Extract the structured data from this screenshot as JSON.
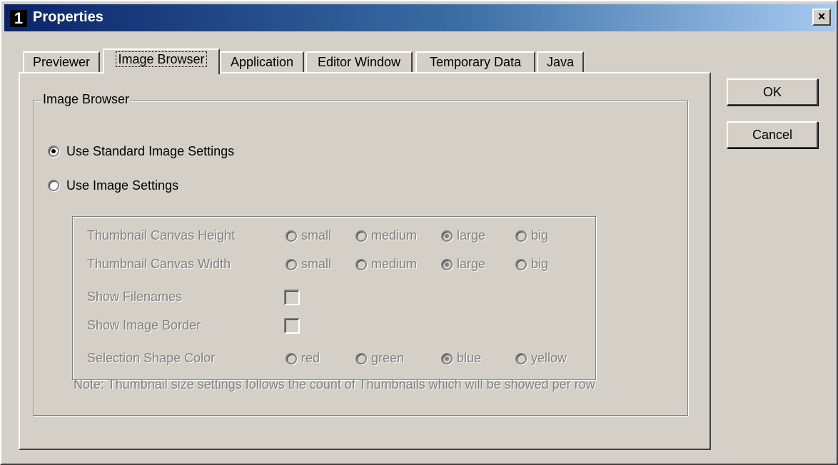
{
  "window": {
    "title": "Properties",
    "app_icon_glyph": "1",
    "close_glyph": "×"
  },
  "tabs": [
    {
      "label": "Previewer"
    },
    {
      "label": "Image Browser",
      "active": true
    },
    {
      "label": "Application"
    },
    {
      "label": "Editor Window"
    },
    {
      "label": "Temporary Data"
    },
    {
      "label": "Java"
    }
  ],
  "group": {
    "legend": "Image Browser",
    "use_standard": {
      "label": "Use Standard Image Settings",
      "checked": true
    },
    "use_custom": {
      "label": "Use Image Settings",
      "checked": false
    }
  },
  "settings": {
    "height": {
      "label": "Thumbnail Canvas Height",
      "options": [
        "small",
        "medium",
        "large",
        "big"
      ],
      "selected": "large"
    },
    "width": {
      "label": "Thumbnail Canvas Width",
      "options": [
        "small",
        "medium",
        "large",
        "big"
      ],
      "selected": "large"
    },
    "show_filenames": {
      "label": "Show Filenames",
      "checked": false
    },
    "show_border": {
      "label": "Show Image Border",
      "checked": false
    },
    "shape_color": {
      "label": "Selection Shape Color",
      "options": [
        "red",
        "green",
        "blue",
        "yellow"
      ],
      "selected": "blue"
    }
  },
  "note": "Note: Thumbnail size settings follows the count of Thumbnails which will be showed per row",
  "buttons": {
    "ok": "OK",
    "cancel": "Cancel"
  },
  "colors": {
    "titlebar_start": "#0a246a",
    "titlebar_end": "#a6caf0",
    "face": "#d4d0c8",
    "disabled_text": "#808080"
  }
}
